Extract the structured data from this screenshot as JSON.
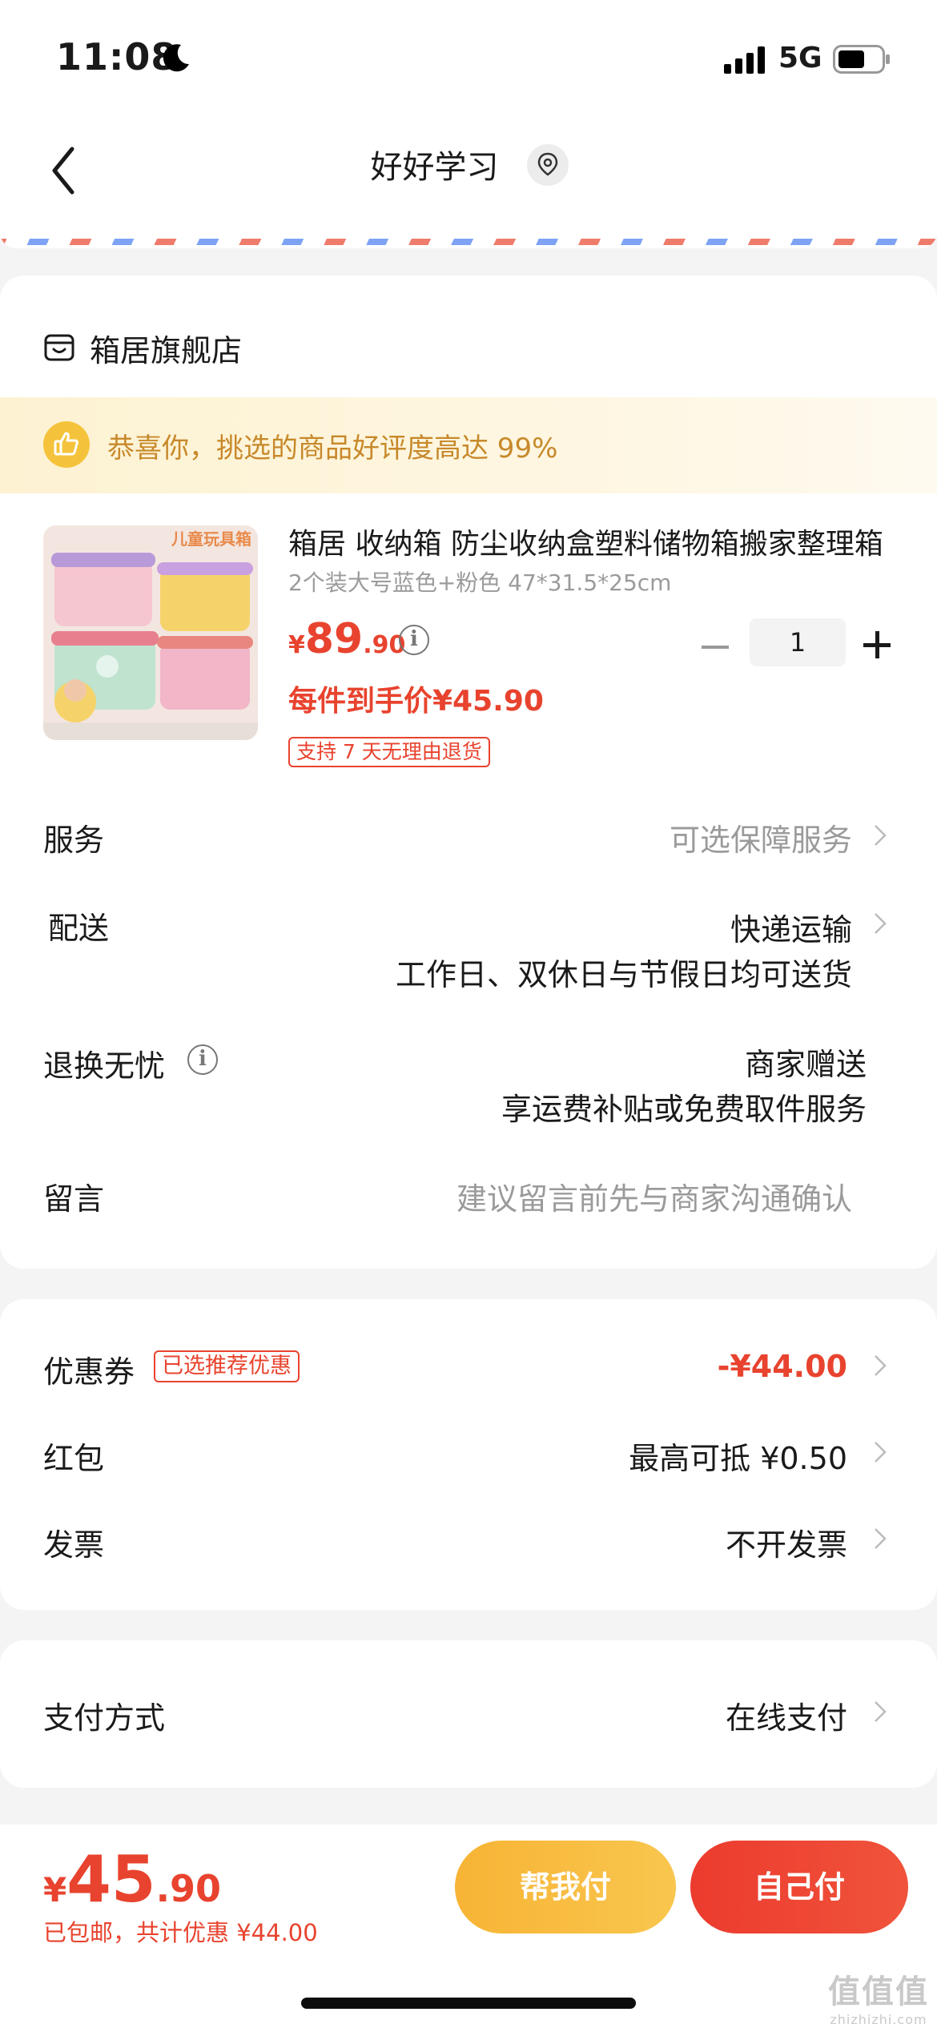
{
  "status_bar": {
    "time": "11:08",
    "network": "5G"
  },
  "nav": {
    "title": "好好学习"
  },
  "store": {
    "name": "箱居旗舰店"
  },
  "praise": {
    "text": "恭喜你，挑选的商品好评度高达 99%"
  },
  "product": {
    "title": "箱居 收纳箱 防尘收纳盒塑料储物箱搬家整理箱",
    "image_caption": "儿童玩具箱",
    "spec": "2个装大号蓝色+粉色 47*31.5*25cm",
    "price_currency": "¥",
    "price_int": "89",
    "price_dec": ".90",
    "quantity": "1",
    "final_price": "每件到手价¥45.90",
    "return_badge": "支持 7 天无理由退货"
  },
  "rows": {
    "service": {
      "label": "服务",
      "value": "可选保障服务"
    },
    "delivery": {
      "label": "配送",
      "value": "快递运输",
      "sub": "工作日、双休日与节假日均可送货"
    },
    "returns": {
      "label": "退换无忧",
      "value": "商家赠送",
      "sub": "享运费补贴或免费取件服务"
    },
    "message": {
      "label": "留言",
      "placeholder": "建议留言前先与商家沟通确认"
    }
  },
  "discounts": {
    "coupon": {
      "label": "优惠券",
      "tag": "已选推荐优惠",
      "value": "-¥44.00"
    },
    "red_packet": {
      "label": "红包",
      "value": "最高可抵 ¥0.50"
    },
    "invoice": {
      "label": "发票",
      "value": "不开发票"
    }
  },
  "payment": {
    "label": "支付方式",
    "value": "在线支付"
  },
  "bottom": {
    "currency": "¥",
    "total_int": "45",
    "total_dec": ".90",
    "summary": "已包邮，共计优惠 ¥44.00",
    "help_pay": "帮我付",
    "self_pay": "自己付"
  },
  "watermark": {
    "main": "值值值",
    "sub": "zhizhizhi.com"
  },
  "colors": {
    "accent_red": "#e8432e",
    "accent_yellow": "#f7b435",
    "praise_text": "#c7892a"
  }
}
